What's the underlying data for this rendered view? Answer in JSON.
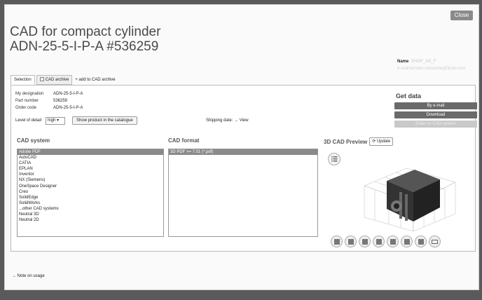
{
  "dialog": {
    "close_label": "Close",
    "title_line1": "CAD for compact cylinder",
    "title_line2": "ADN-25-5-I-P-A #536259",
    "name_label": "Name",
    "name_value": "EHOF_DE_F",
    "email_value": "e-mail:kunden.menashia@festo.com"
  },
  "tabs": {
    "selection": "Selection",
    "cad_archive": "CAD archive",
    "add_to_archive": "+ add to CAD archive"
  },
  "info": {
    "my_designation_label": "My designation",
    "my_designation_value": "ADN-25-5-I-P-A",
    "part_number_label": "Part number",
    "part_number_value": "536259",
    "order_code_label": "Order code",
    "order_code_value": "ADN-25-5-I-P-A",
    "level_of_detail_label": "Level of detail",
    "level_of_detail_value": "high",
    "show_product_label": "Show product in the catalogue",
    "shipping_label": "Shipping date: → View"
  },
  "get_data": {
    "title": "Get data",
    "by_email": "By e-mail",
    "download": "Download",
    "enter_cad": "Enter on CAD system"
  },
  "cad_system": {
    "header": "CAD system",
    "items": [
      "Adobe PDF",
      "AutoCAD",
      "CATIA",
      "EPLAN",
      "Inventor",
      "NX (Siemens)",
      "OneSpace Designer",
      "Creo",
      "SolidEdge",
      "SolidWorks",
      "...other CAD systems",
      "Neutral 3D",
      "Neutral 2D"
    ],
    "selected": "Adobe PDF"
  },
  "cad_format": {
    "header": "CAD format",
    "items": [
      "3D PDF >= 7.01 (*.pdf)"
    ],
    "selected": "3D PDF >= 7.01 (*.pdf)"
  },
  "preview": {
    "header": "3D CAD Preview",
    "update_label": "Update",
    "view_icons": [
      "iso-view-icon",
      "wireframe-icon",
      "shaded-icon",
      "hidden-line-icon",
      "front-view-icon",
      "top-view-icon",
      "side-view-icon",
      "screen-icon"
    ]
  },
  "footer": {
    "note": "→ Note on usage"
  },
  "colors": {
    "button_dark": "#6a6a6a",
    "selection": "#8a8a8a",
    "disabled": "#c9c9c9"
  }
}
